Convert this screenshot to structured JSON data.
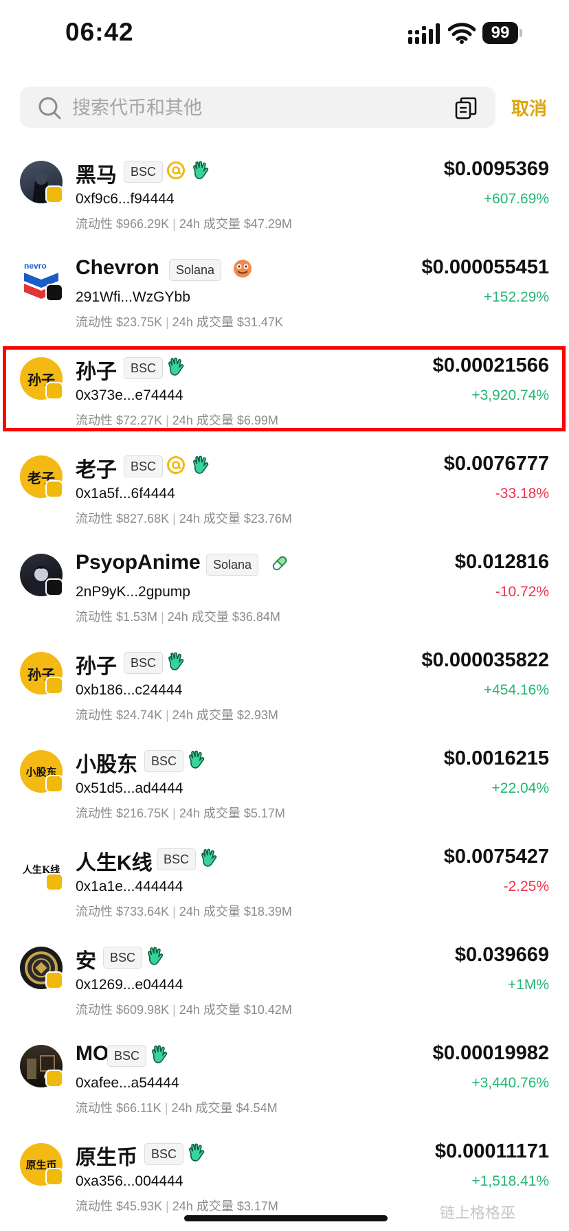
{
  "status_bar": {
    "time": "06:42",
    "battery": "99"
  },
  "search": {
    "placeholder": "搜索代币和其他",
    "value": "",
    "cancel_label": "取消"
  },
  "labels": {
    "liquidity": "流动性",
    "volume": "24h 成交量"
  },
  "colors": {
    "accent": "#d9a50a",
    "up": "#22b873",
    "down": "#f0324a",
    "highlight": "#ff0000"
  },
  "tokens": [
    {
      "name": "黑马",
      "chain": "BSC",
      "icons": [
        "at-icon",
        "wave-hand-icon"
      ],
      "address": "0xf9c6...f94444",
      "liquidity": "$966.29K",
      "volume": "$47.29M",
      "price": "$0.0095369",
      "change": "+607.69%",
      "direction": "up",
      "avatar": "dark-knight-avatar"
    },
    {
      "name": "Chevron",
      "chain": "Solana",
      "icons": [
        "frog-icon"
      ],
      "address": "291Wfi...WzGYbb",
      "liquidity": "$23.75K",
      "volume": "$31.47K",
      "price": "$0.000055451",
      "change": "+152.29%",
      "direction": "up",
      "avatar": "chevron-logo-avatar"
    },
    {
      "name": "孙子",
      "chain": "BSC",
      "icons": [
        "wave-hand-icon"
      ],
      "address": "0x373e...e74444",
      "liquidity": "$72.27K",
      "volume": "$6.99M",
      "price": "$0.00021566",
      "change": "+3,920.74%",
      "direction": "up",
      "avatar": "孙子",
      "highlighted": true
    },
    {
      "name": "老子",
      "chain": "BSC",
      "icons": [
        "at-icon",
        "wave-hand-icon"
      ],
      "address": "0x1a5f...6f4444",
      "liquidity": "$827.68K",
      "volume": "$23.76M",
      "price": "$0.0076777",
      "change": "-33.18%",
      "direction": "down",
      "avatar": "老子"
    },
    {
      "name": "PsyopAnime",
      "chain": "Solana",
      "icons": [
        "pill-icon"
      ],
      "address": "2nP9yK...2gpump",
      "liquidity": "$1.53M",
      "volume": "$36.84M",
      "price": "$0.012816",
      "change": "-10.72%",
      "direction": "down",
      "avatar": "anime-avatar"
    },
    {
      "name": "孙子",
      "chain": "BSC",
      "icons": [
        "wave-hand-icon"
      ],
      "address": "0xb186...c24444",
      "liquidity": "$24.74K",
      "volume": "$2.93M",
      "price": "$0.000035822",
      "change": "+454.16%",
      "direction": "up",
      "avatar": "孙子"
    },
    {
      "name": "小股东",
      "chain": "BSC",
      "icons": [
        "wave-hand-icon"
      ],
      "address": "0x51d5...ad4444",
      "liquidity": "$216.75K",
      "volume": "$5.17M",
      "price": "$0.0016215",
      "change": "+22.04%",
      "direction": "up",
      "avatar": "小股东"
    },
    {
      "name": "人生K线",
      "chain": "BSC",
      "icons": [
        "wave-hand-icon"
      ],
      "address": "0x1a1e...444444",
      "liquidity": "$733.64K",
      "volume": "$18.39M",
      "price": "$0.0075427",
      "change": "-2.25%",
      "direction": "down",
      "avatar": "人生K线"
    },
    {
      "name": "安",
      "chain": "BSC",
      "icons": [
        "wave-hand-icon"
      ],
      "address": "0x1269...e04444",
      "liquidity": "$609.98K",
      "volume": "$10.42M",
      "price": "$0.039669",
      "change": "+1M%",
      "direction": "up",
      "avatar": "coin-avatar"
    },
    {
      "name": "MO",
      "chain": "BSC",
      "icons": [
        "wave-hand-icon"
      ],
      "address": "0xafee...a54444",
      "liquidity": "$66.11K",
      "volume": "$4.54M",
      "price": "$0.00019982",
      "change": "+3,440.76%",
      "direction": "up",
      "avatar": "room-photo-avatar"
    },
    {
      "name": "原生币",
      "chain": "BSC",
      "icons": [
        "wave-hand-icon"
      ],
      "address": "0xa356...004444",
      "liquidity": "$45.93K",
      "volume": "$3.17M",
      "price": "$0.00011171",
      "change": "+1,518.41%",
      "direction": "up",
      "avatar": "原生币"
    }
  ],
  "watermark": "链上格格巫"
}
